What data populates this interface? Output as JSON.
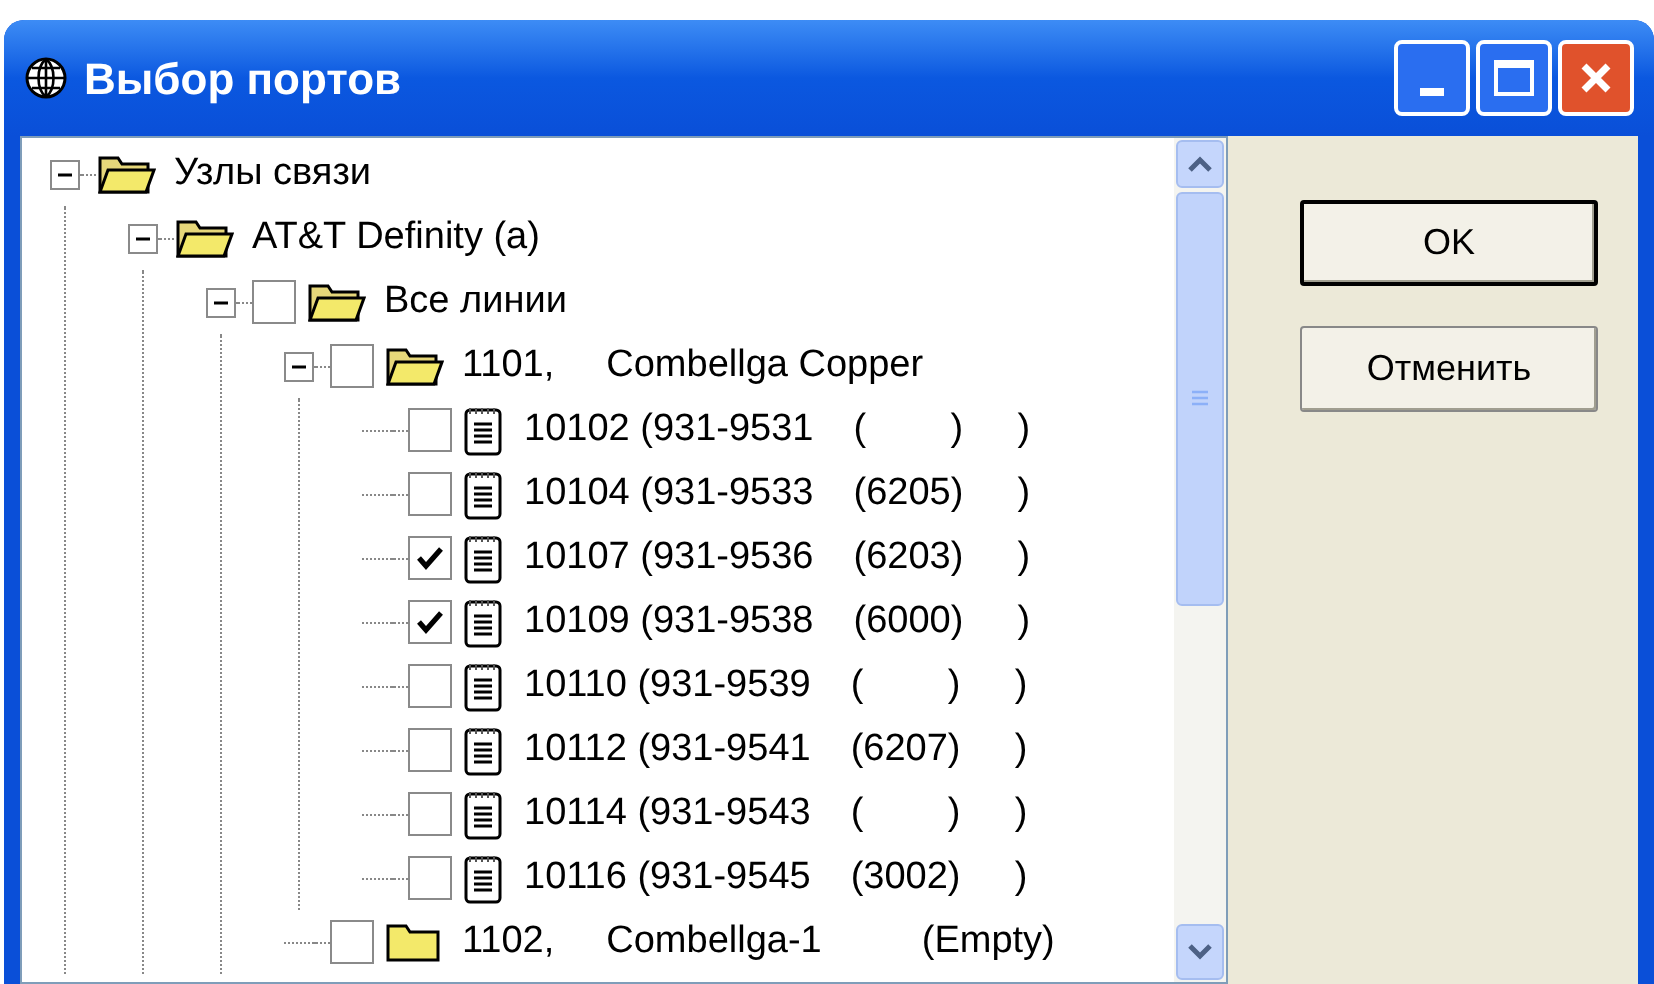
{
  "window": {
    "title": "Выбор портов"
  },
  "tree": [
    {
      "kind": "group",
      "parts": [
        "Узлы связи"
      ],
      "expanded": true,
      "children": [
        {
          "kind": "group",
          "parts": [
            "AT&T Definity (a)"
          ],
          "expanded": true,
          "children": [
            {
              "kind": "folder",
              "parts": [
                "Все линии"
              ],
              "checked": false,
              "expanded": true,
              "children": [
                {
                  "kind": "folder",
                  "parts": [
                    "1101,",
                    "Combellga Copper"
                  ],
                  "checked": false,
                  "expanded": true,
                  "children": [
                    {
                      "kind": "line",
                      "parts": [
                        "10102 (931-9531",
                        "(        )",
                        ")"
                      ],
                      "checked": false
                    },
                    {
                      "kind": "line",
                      "parts": [
                        "10104 (931-9533",
                        "(6205)",
                        ")"
                      ],
                      "checked": false
                    },
                    {
                      "kind": "line",
                      "parts": [
                        "10107 (931-9536",
                        "(6203)",
                        ")"
                      ],
                      "checked": true
                    },
                    {
                      "kind": "line",
                      "parts": [
                        "10109 (931-9538",
                        "(6000)",
                        ")"
                      ],
                      "checked": true
                    },
                    {
                      "kind": "line",
                      "parts": [
                        "10110 (931-9539",
                        "(        )",
                        ")"
                      ],
                      "checked": false
                    },
                    {
                      "kind": "line",
                      "parts": [
                        "10112 (931-9541",
                        "(6207)",
                        ")"
                      ],
                      "checked": false
                    },
                    {
                      "kind": "line",
                      "parts": [
                        "10114 (931-9543",
                        "(        )",
                        ")"
                      ],
                      "checked": false
                    },
                    {
                      "kind": "line",
                      "parts": [
                        "10116 (931-9545",
                        "(3002)",
                        ")"
                      ],
                      "checked": false
                    }
                  ]
                },
                {
                  "kind": "folder",
                  "parts": [
                    "1102,",
                    "Combellga-1",
                    "(Empty)"
                  ],
                  "checked": false,
                  "expanded": false
                }
              ]
            }
          ]
        }
      ]
    }
  ],
  "buttons": [
    {
      "label": "OK",
      "default": true
    },
    {
      "label": "Отменить",
      "default": false
    }
  ]
}
